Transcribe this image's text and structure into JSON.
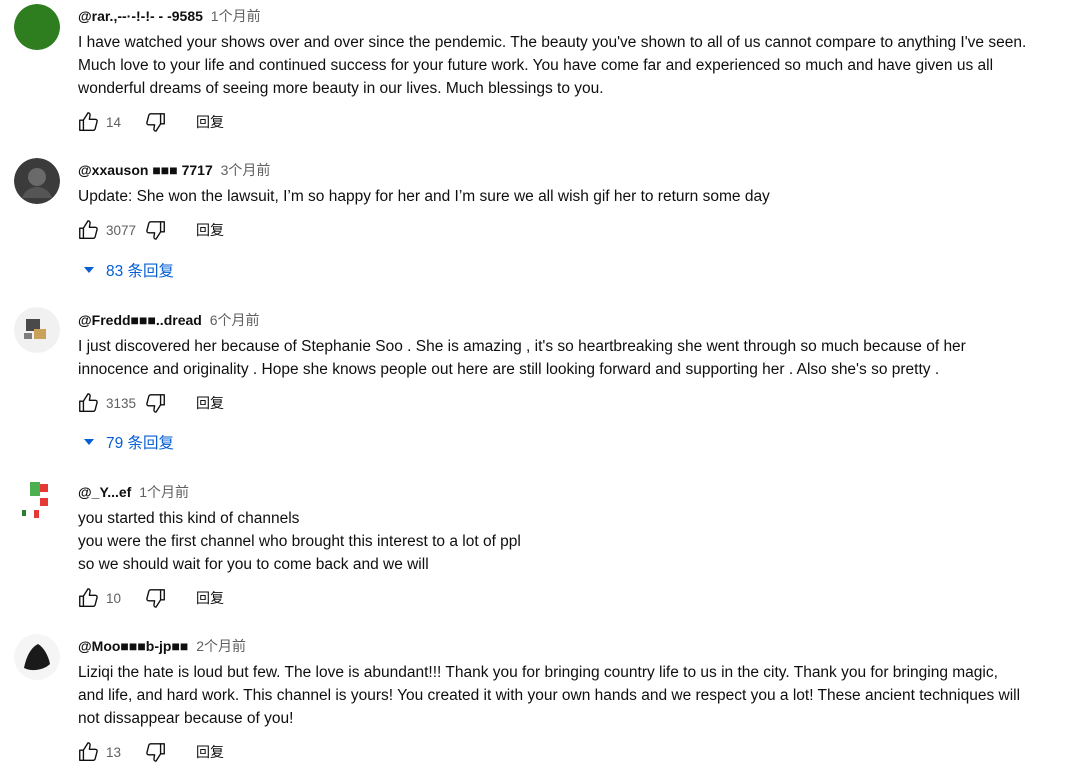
{
  "comments": [
    {
      "author": "@rar.,--·-!-!- - -9585",
      "time": "1个月前",
      "lines": [
        "I have watched your shows over and over since the pendemic. The beauty you've shown to all of us cannot compare to anything I've seen.",
        "Much love to your life and continued success for your future work.  You have come far and experienced so much and have given us all",
        "wonderful dreams of seeing more beauty in our lives.  Much blessings to you."
      ],
      "likes": "14",
      "reply_label": "回复"
    },
    {
      "author": "@xxauson ■■■ 7717",
      "time": "3个月前",
      "lines": [
        "Update: She won the lawsuit, I’m so happy for her and I’m sure we all wish gif her to return some day"
      ],
      "likes": "3077",
      "reply_label": "回复",
      "replies": "83 条回复"
    },
    {
      "author": "@Fredd■■■..dread",
      "time": "6个月前",
      "lines": [
        "I just discovered her because of Stephanie Soo . She is amazing , it's so heartbreaking she went through so much because of her",
        "innocence and originality . Hope she knows people out here are still looking forward and supporting her . Also she's so pretty ."
      ],
      "likes": "3135",
      "reply_label": "回复",
      "replies": "79 条回复"
    },
    {
      "author": "@_Y...ef",
      "time": "1个月前",
      "lines": [
        "you started this kind of channels",
        "you were the first channel who brought this interest to a lot of ppl",
        "so we should wait for you to come back and we will"
      ],
      "likes": "10",
      "reply_label": "回复"
    },
    {
      "author": "@Moo■■■b-jp■■",
      "time": "2个月前",
      "lines": [
        "Liziqi the hate is loud but few. The love is abundant!!! Thank you for bringing country life to us in the city. Thank you for bringing magic,",
        "and life, and hard work. This channel is yours! You created it with your own hands and we respect you a lot! These ancient techniques will",
        "not dissappear because of you!"
      ],
      "likes": "13",
      "reply_label": "回复"
    }
  ]
}
